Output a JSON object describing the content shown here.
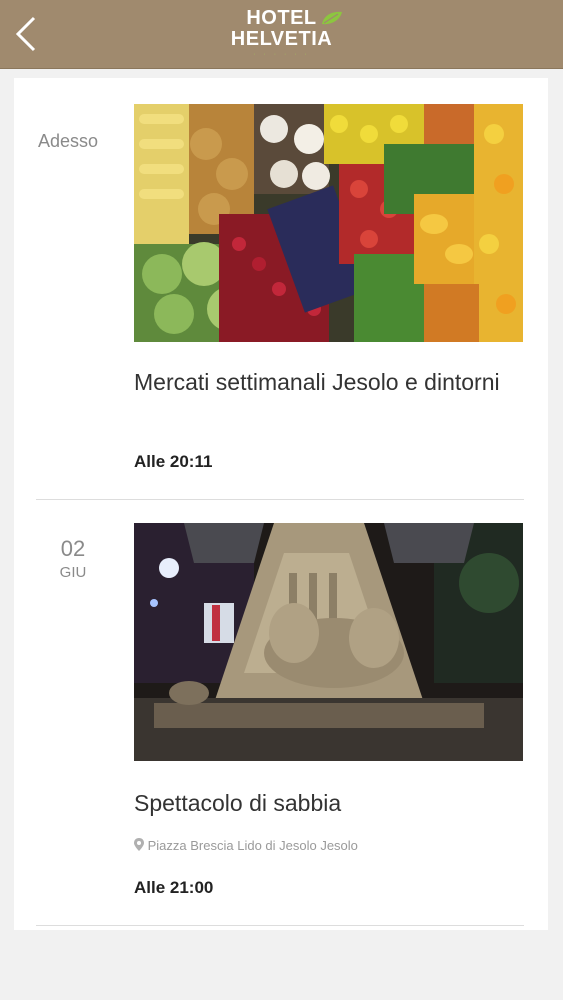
{
  "header": {
    "back_icon": "chevron-left-icon",
    "logo_line1": "HOTEL",
    "logo_line2": "HELVETIA",
    "brand_color": "#a08a6e"
  },
  "events": [
    {
      "date_label": "Adesso",
      "image": "fruit-vegetable-market-photo",
      "title": "Mercati settimanali Jesolo e dintorni",
      "time": "Alle 20:11"
    },
    {
      "date_day": "02",
      "date_month": "GIU",
      "image": "sand-sculpture-photo",
      "title": "Spettacolo di sabbia",
      "location": "Piazza Brescia Lido di Jesolo Jesolo",
      "location_icon": "map-pin-icon",
      "time": "Alle 21:00"
    }
  ]
}
